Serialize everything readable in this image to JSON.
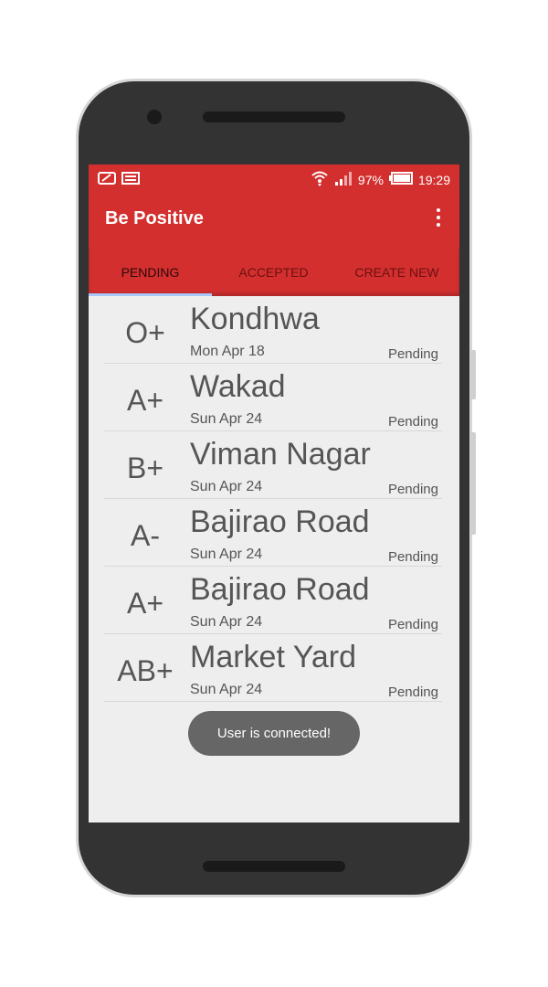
{
  "statusbar": {
    "battery_percent": "97%",
    "time": "19:29"
  },
  "appbar": {
    "title": "Be Positive"
  },
  "tabs": [
    {
      "label": "PENDING",
      "active": true
    },
    {
      "label": "ACCEPTED",
      "active": false
    },
    {
      "label": "CREATE NEW",
      "active": false
    }
  ],
  "requests": [
    {
      "blood_group": "O+",
      "location": "Kondhwa",
      "date": "Mon Apr 18",
      "status": "Pending"
    },
    {
      "blood_group": "A+",
      "location": "Wakad",
      "date": "Sun Apr 24",
      "status": "Pending"
    },
    {
      "blood_group": "B+",
      "location": "Viman Nagar",
      "date": "Sun Apr 24",
      "status": "Pending"
    },
    {
      "blood_group": "A-",
      "location": "Bajirao Road",
      "date": "Sun Apr 24",
      "status": "Pending"
    },
    {
      "blood_group": "A+",
      "location": "Bajirao Road",
      "date": "Sun Apr 24",
      "status": "Pending"
    },
    {
      "blood_group": "AB+",
      "location": "Market Yard",
      "date": "Sun Apr 24",
      "status": "Pending"
    }
  ],
  "toast": {
    "message": "User is connected!"
  },
  "colors": {
    "primary": "#d32f2f",
    "tab_indicator": "#a8c6ff",
    "background": "#eeeeee"
  }
}
